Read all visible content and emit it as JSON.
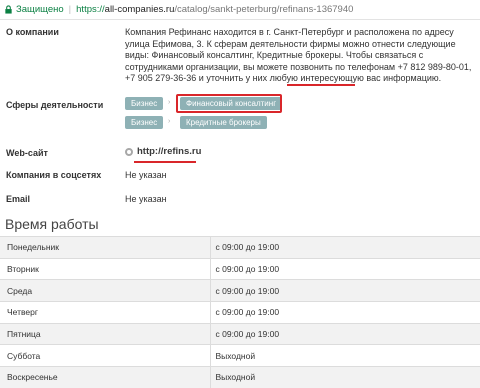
{
  "browser": {
    "secure_label": "Защищено",
    "url_scheme": "https://",
    "url_host": "all-companies.ru",
    "url_path": "/catalog/sankt-peterburg/refinans-1367940"
  },
  "about": {
    "label": "О компании",
    "text": "Компания Рефинанс находится в г. Санкт-Петербург и расположена по адресу улица Ефимова, 3. К сферам деятельности фирмы можно отнести следующие виды: Финансовый консалтинг, Кредитные брокеры. Чтобы связаться с сотрудниками организации, вы можете позвонить по телефонам +7 812 989-80-01, +7 905 279-36-36 и уточнить у них любую интересующую вас информацию."
  },
  "activities": {
    "label": "Сферы деятельности",
    "tags": [
      "Бизнес",
      "Финансовый консалтинг",
      "Бизнес",
      "Кредитные брокеры"
    ],
    "separator": "›"
  },
  "website": {
    "label": "Web-сайт",
    "link": "http://refins.ru"
  },
  "social": {
    "label": "Компания в соцсетях",
    "value": "Не указан"
  },
  "email": {
    "label": "Email",
    "value": "Не указан"
  },
  "hours": {
    "title": "Время работы",
    "rows": [
      {
        "day": "Понедельник",
        "time": "с 09:00 до 19:00"
      },
      {
        "day": "Вторник",
        "time": "с 09:00 до 19:00"
      },
      {
        "day": "Среда",
        "time": "с 09:00 до 19:00"
      },
      {
        "day": "Четверг",
        "time": "с 09:00 до 19:00"
      },
      {
        "day": "Пятница",
        "time": "с 09:00 до 19:00"
      },
      {
        "day": "Суббота",
        "time": "Выходной"
      },
      {
        "day": "Воскресенье",
        "time": "Выходной"
      }
    ]
  },
  "colors": {
    "tag_bg": "#8eb1b5",
    "highlight_red": "#d9262a",
    "secure_green": "#0b8043"
  }
}
